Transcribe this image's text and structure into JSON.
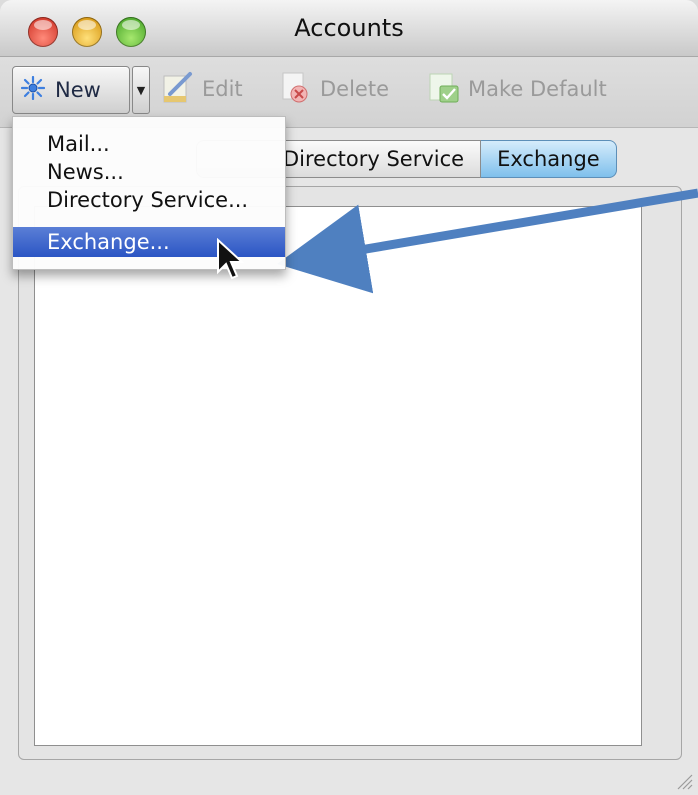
{
  "window": {
    "title": "Accounts"
  },
  "colors": {
    "accent": "#2b55c4",
    "annotation_arrow": "#4f80c0",
    "active_tab": "#7fc0ec"
  },
  "toolbar": {
    "new_label": "New",
    "edit_label": "Edit",
    "delete_label": "Delete",
    "make_default_label": "Make Default",
    "icons": {
      "new": "sparkle-icon",
      "edit": "pencil-document-icon",
      "delete": "trash-document-icon",
      "make_default": "checkmark-document-icon"
    }
  },
  "new_menu": {
    "items": [
      {
        "label": "Mail..."
      },
      {
        "label": "News..."
      },
      {
        "label": "Directory Service..."
      },
      {
        "label": "Exchange...",
        "highlighted": true
      }
    ]
  },
  "tabs": [
    {
      "label": "Directory Service"
    },
    {
      "label": "Exchange",
      "active": true
    }
  ]
}
